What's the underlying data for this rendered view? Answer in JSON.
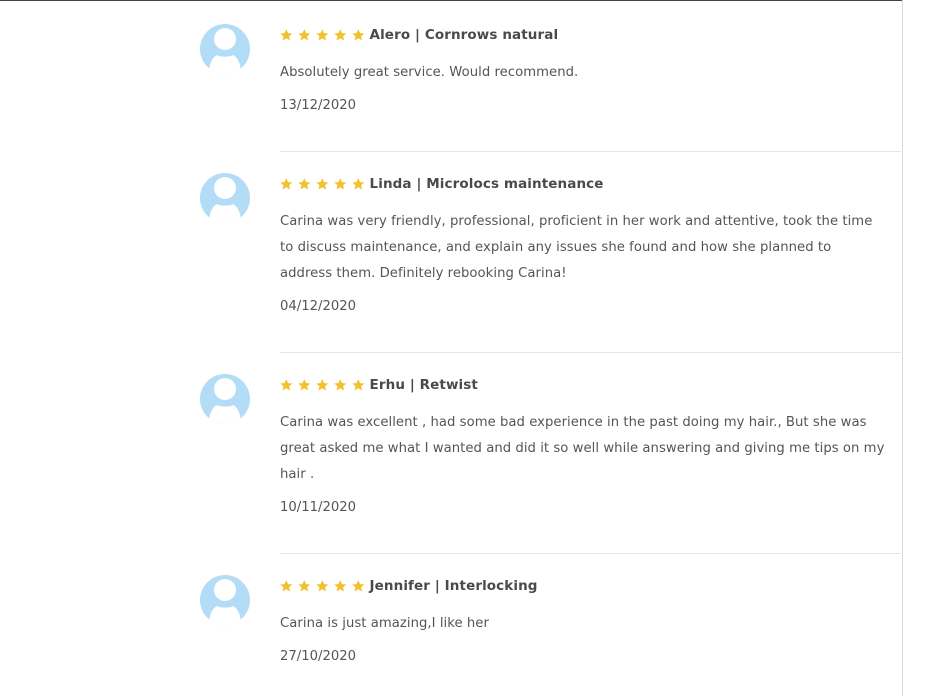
{
  "colors": {
    "star": "#f2c12e",
    "avatar": "#b3dcf6",
    "reviewer_text": "#4a4a4a",
    "body_text": "#555555",
    "divider": "#e6e6e6"
  },
  "reviews": [
    {
      "reviewer": "Alero | Cornrows natural",
      "rating": 5,
      "text": "Absolutely great service. Would recommend.",
      "date": "13/12/2020",
      "avatar_icon": "user-silhouette-icon"
    },
    {
      "reviewer": "Linda | Microlocs maintenance",
      "rating": 5,
      "text": "Carina was very friendly, professional, proficient in her work and attentive, took the time to discuss maintenance, and explain any issues she found and how she planned to address them. Definitely rebooking Carina!",
      "date": "04/12/2020",
      "avatar_icon": "user-silhouette-icon"
    },
    {
      "reviewer": "Erhu | Retwist",
      "rating": 5,
      "text": "Carina was excellent , had some bad experience in the past doing my hair., But she was great asked me what I wanted and did it so well while answering and giving me tips on my hair .",
      "date": "10/11/2020",
      "avatar_icon": "user-silhouette-icon"
    },
    {
      "reviewer": "Jennifer | Interlocking",
      "rating": 5,
      "text": "Carina is just amazing,I like her",
      "date": "27/10/2020",
      "avatar_icon": "user-silhouette-icon"
    }
  ]
}
